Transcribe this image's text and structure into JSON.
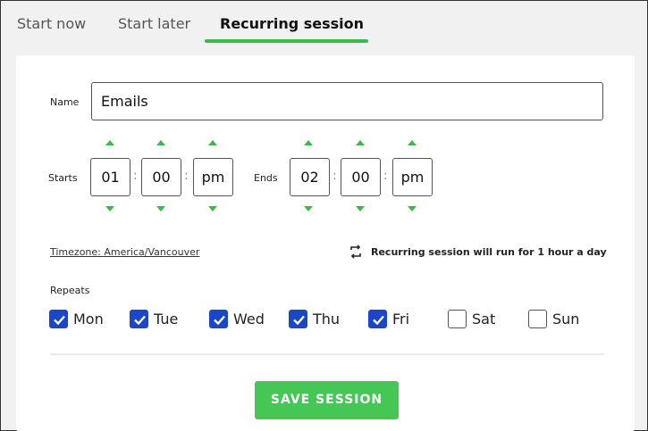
{
  "tabs": [
    {
      "label": "Start now"
    },
    {
      "label": "Start later"
    },
    {
      "label": "Recurring session",
      "active": true
    }
  ],
  "form": {
    "name_label": "Name",
    "name_value": "Emails",
    "starts_label": "Starts",
    "ends_label": "Ends",
    "start_time": {
      "hour": "01",
      "minute": "00",
      "period": "pm"
    },
    "end_time": {
      "hour": "02",
      "minute": "00",
      "period": "pm"
    },
    "time_separator": ":",
    "timezone_link": "Timezone: America/Vancouver",
    "recurring_info": "Recurring session will run for 1 hour a day",
    "repeats_label": "Repeats",
    "days": [
      {
        "label": "Mon",
        "checked": true
      },
      {
        "label": "Tue",
        "checked": true
      },
      {
        "label": "Wed",
        "checked": true
      },
      {
        "label": "Thu",
        "checked": true
      },
      {
        "label": "Fri",
        "checked": true
      },
      {
        "label": "Sat",
        "checked": false
      },
      {
        "label": "Sun",
        "checked": false
      }
    ],
    "save_label": "SAVE SESSION"
  },
  "colors": {
    "accent_green": "#3cb94a",
    "checkbox_blue": "#1a47c9",
    "save_button": "#46c655"
  },
  "icons": {
    "increment": "caret-up-icon",
    "decrement": "caret-down-icon",
    "recurring": "repeat-icon",
    "checked": "checkmark-icon"
  }
}
